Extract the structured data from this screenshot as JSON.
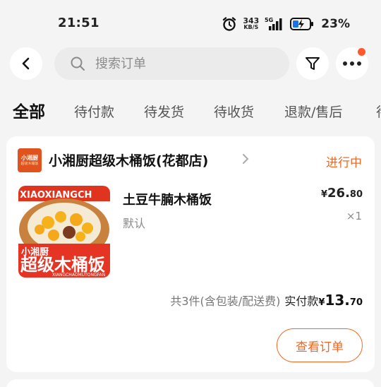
{
  "status_bar": {
    "time": "21:51",
    "net_speed_value": "343",
    "net_speed_unit": "KB/S",
    "signal_label": "5G",
    "battery": "23%"
  },
  "header": {
    "search_placeholder": "搜索订单",
    "icons": [
      "back-arrow-icon",
      "search-icon",
      "filter-icon",
      "more-icon"
    ]
  },
  "tabs": [
    {
      "label": "全部",
      "active": true
    },
    {
      "label": "待付款"
    },
    {
      "label": "待发货"
    },
    {
      "label": "待收货"
    },
    {
      "label": "退款/售后"
    },
    {
      "label": "待"
    }
  ],
  "order": {
    "store_logo_text": "小湘厨",
    "store_logo_sub": "超级木桶饭",
    "store_name": "小湘厨超级木桶饭(花都店)",
    "status": "进行中",
    "item": {
      "name": "土豆牛腩木桶饭",
      "spec": "默认",
      "price_currency": "¥",
      "price_int": "26.",
      "price_dec": "80",
      "qty": "×1",
      "image_text_top": "XIAOXIANGCH",
      "image_text_brand": "小湘厨",
      "image_text_main": "超级木桶饭",
      "image_text_sub": "XIANGCHAOMUTONGFAN"
    },
    "summary_info": "共3件(含包装/配送费)",
    "paid_label": "实付款",
    "paid_currency": "¥",
    "paid_int": "13.",
    "paid_dec": "70",
    "view_button": "查看订单"
  },
  "colors": {
    "accent": "#f2661f",
    "badge": "#ff5a2e",
    "background": "#f4f4f4"
  }
}
